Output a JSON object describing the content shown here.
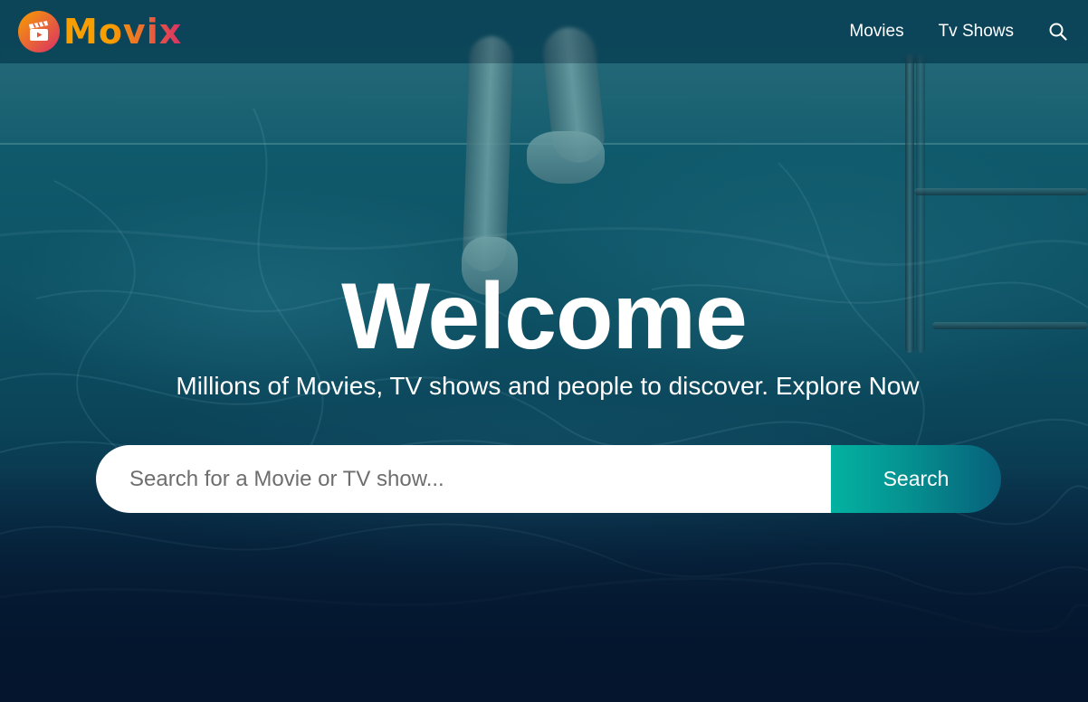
{
  "header": {
    "brand": "Movix",
    "nav": [
      {
        "label": "Movies"
      },
      {
        "label": "Tv Shows"
      }
    ],
    "search_icon": "search-icon"
  },
  "hero": {
    "title": "Welcome",
    "subtitle": "Millions of Movies, TV shows and people to discover. Explore Now",
    "search": {
      "placeholder": "Search for a Movie or TV show...",
      "value": "",
      "button_label": "Search"
    }
  },
  "colors": {
    "brand_orange": "#f89e00",
    "brand_pink": "#da2f68",
    "button_gradient_start": "#03b2a1",
    "button_gradient_end": "#07607a",
    "background": "#04152d"
  }
}
